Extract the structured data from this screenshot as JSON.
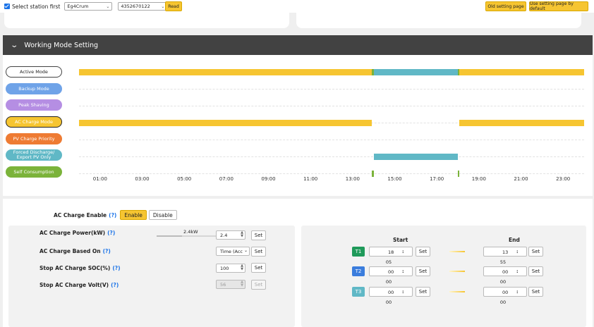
{
  "topbar": {
    "select_label": "Select station first",
    "station_value": "Eg4Crum",
    "serial_value": "4352670122",
    "read_label": "Read",
    "old_setting_label": "Old setting page",
    "default_setting_label": "Use setting page by default"
  },
  "section": {
    "title": "Working Mode Setting"
  },
  "modes": [
    {
      "label": "Active Mode",
      "color": "#ffffff"
    },
    {
      "label": "Backup Mode",
      "color": "#6fa3e8"
    },
    {
      "label": "Peak Shaving",
      "color": "#b58ee3"
    },
    {
      "label": "AC Charge Mode",
      "color": "#f6c531"
    },
    {
      "label": "PV Charge Priority",
      "color": "#ee7b33"
    },
    {
      "label": "Forced Discharge/\nExport PV Only",
      "color": "#60b8c6"
    },
    {
      "label": "Self Consumption",
      "color": "#7bb33a"
    }
  ],
  "chart_data": {
    "type": "bar",
    "x_ticks": [
      "01:00",
      "03:00",
      "05:00",
      "07:00",
      "09:00",
      "11:00",
      "13:00",
      "15:00",
      "17:00",
      "19:00",
      "21:00",
      "23:00"
    ],
    "xlim": [
      "00:00",
      "24:00"
    ],
    "rows": [
      {
        "segments": [
          {
            "start": "00:00",
            "end": "13:55",
            "color": "#f6c531"
          },
          {
            "start": "13:55",
            "end": "14:00",
            "color": "#7bb33a"
          },
          {
            "start": "14:00",
            "end": "18:00",
            "color": "#60b8c6"
          },
          {
            "start": "18:00",
            "end": "18:05",
            "color": "#7bb33a"
          },
          {
            "start": "18:05",
            "end": "24:00",
            "color": "#f6c531"
          }
        ]
      },
      {
        "segments": []
      },
      {
        "segments": []
      },
      {
        "segments": [
          {
            "start": "00:00",
            "end": "13:55",
            "color": "#f6c531"
          },
          {
            "start": "18:05",
            "end": "24:00",
            "color": "#f6c531"
          }
        ]
      },
      {
        "segments": []
      },
      {
        "segments": [
          {
            "start": "14:00",
            "end": "18:00",
            "color": "#60b8c6"
          }
        ]
      },
      {
        "segments": [
          {
            "start": "13:55",
            "end": "14:00",
            "color": "#7bb33a"
          },
          {
            "start": "18:00",
            "end": "18:05",
            "color": "#7bb33a"
          }
        ]
      }
    ],
    "grid": true
  },
  "ac": {
    "enable_label": "AC Charge Enable",
    "help": "(?)",
    "enable_btn": "Enable",
    "disable_btn": "Disable",
    "power_label": "AC Charge Power(kW)",
    "power_slider_text": "2.4kW",
    "power_slider_level": 0.4,
    "power_value": "2.4",
    "based_on_label": "AC Charge Based On",
    "based_on_value": "Time (Acc",
    "stop_soc_label": "Stop AC Charge SOC(%)",
    "stop_soc_value": "100",
    "stop_volt_label": "Stop AC Charge Volt(V)",
    "stop_volt_value": "56",
    "set_label": "Set"
  },
  "time": {
    "start_header": "Start",
    "end_header": "End",
    "set_label": "Set",
    "colon": ":",
    "slots": [
      {
        "label": "T1",
        "color": "#1f9a5a",
        "start_h": "18",
        "start_m": "05",
        "end_h": "13",
        "end_m": "55"
      },
      {
        "label": "T2",
        "color": "#3b7ddd",
        "start_h": "00",
        "start_m": "00",
        "end_h": "00",
        "end_m": "00"
      },
      {
        "label": "T3",
        "color": "#60b8c6",
        "start_h": "00",
        "start_m": "00",
        "end_h": "00",
        "end_m": "00"
      }
    ]
  }
}
